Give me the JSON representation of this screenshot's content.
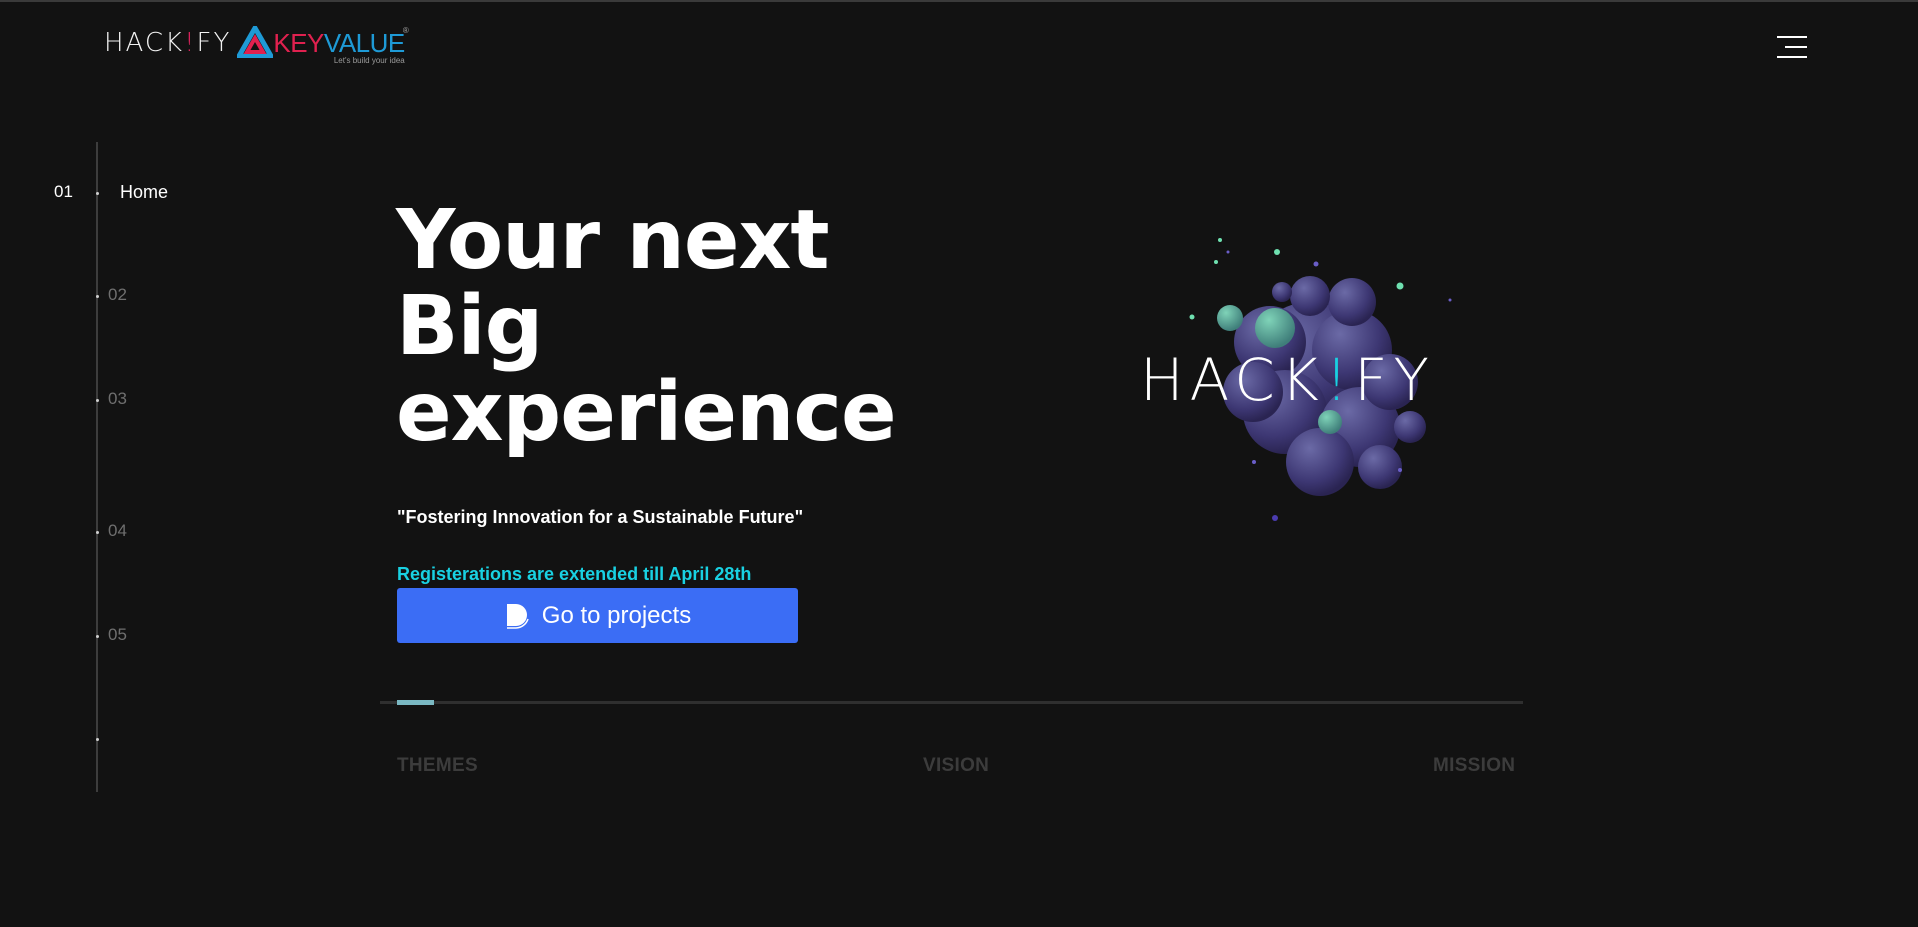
{
  "header": {
    "logo_hackify_pre": "HACK",
    "logo_hackify_bang": "!",
    "logo_hackify_post": "FY",
    "logo_key": "KEY",
    "logo_value": "VALUE",
    "logo_tagline": "Let's build your idea",
    "menu_icon": "hamburger-menu-icon"
  },
  "side_nav": {
    "items": [
      {
        "number": "01",
        "label": "Home",
        "active": true
      },
      {
        "number": "02"
      },
      {
        "number": "03"
      },
      {
        "number": "04"
      },
      {
        "number": "05"
      }
    ]
  },
  "hero": {
    "title_lines": [
      "Your next",
      "Big",
      "experience"
    ],
    "quote": "\"Fostering Innovation for a Sustainable Future\"",
    "registration_note": "Registerations are extended till April 28th",
    "cta_label": "Go to projects",
    "cta_icon": "projects-icon",
    "art_word_pre": "HACK",
    "art_word_bang": "!",
    "art_word_post": "FY"
  },
  "progress": {
    "value": 0.027
  },
  "tabs": [
    {
      "label": "THEMES"
    },
    {
      "label": "VISION"
    },
    {
      "label": "MISSION"
    }
  ],
  "colors": {
    "background": "#121212",
    "accent_blue": "#3b6df5",
    "accent_cyan": "#19d1e2",
    "brand_red": "#e0214f",
    "brand_blue": "#1e9ad6",
    "progress": "#7ab8c2"
  }
}
